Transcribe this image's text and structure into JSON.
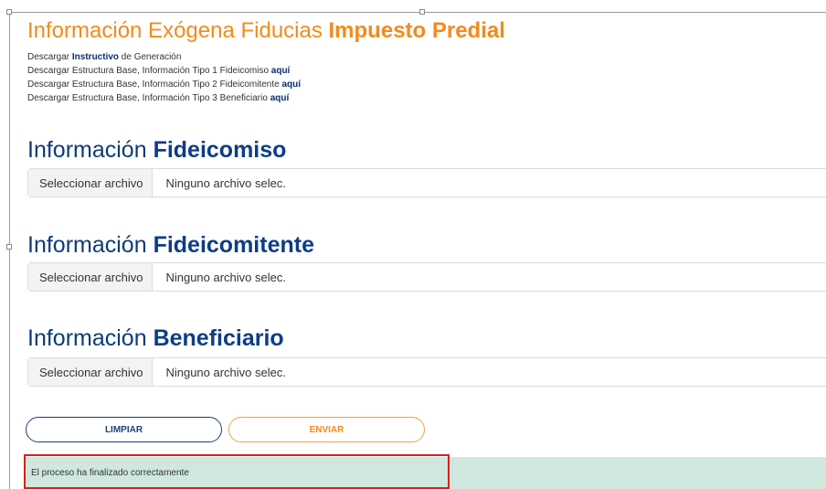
{
  "header": {
    "title_light": "Información Exógena Fiducias ",
    "title_bold": "Impuesto Predial"
  },
  "downloads": {
    "instructivo": {
      "prefix": "Descargar ",
      "link": "Instructivo",
      "suffix": " de Generación"
    },
    "tipo1": {
      "text": "Descargar Estructura Base, Información Tipo 1 Fideicomiso ",
      "link": "aquí"
    },
    "tipo2": {
      "text": "Descargar Estructura Base, Información Tipo 2 Fideicomitente ",
      "link": "aquí"
    },
    "tipo3": {
      "text": "Descargar Estructura Base, Información Tipo 3 Beneficiario ",
      "link": "aquí"
    }
  },
  "sections": {
    "fideicomiso": {
      "title_light": "Información ",
      "title_bold": "Fideicomiso",
      "button": "Seleccionar archivo",
      "status": "Ninguno archivo selec."
    },
    "fideicomitente": {
      "title_light": "Información ",
      "title_bold": "Fideicomitente",
      "button": "Seleccionar archivo",
      "status": "Ninguno archivo selec."
    },
    "beneficiario": {
      "title_light": "Información ",
      "title_bold": "Beneficiario",
      "button": "Seleccionar archivo",
      "status": "Ninguno archivo selec."
    }
  },
  "actions": {
    "clear": "LIMPIAR",
    "send": "ENVIAR"
  },
  "alert": {
    "message": "El proceso ha finalizado correctamente"
  },
  "colors": {
    "orange": "#f28a1e",
    "navy": "#0d3b7a",
    "success_bg": "#cfe7dd",
    "highlight_red": "#d82020"
  }
}
